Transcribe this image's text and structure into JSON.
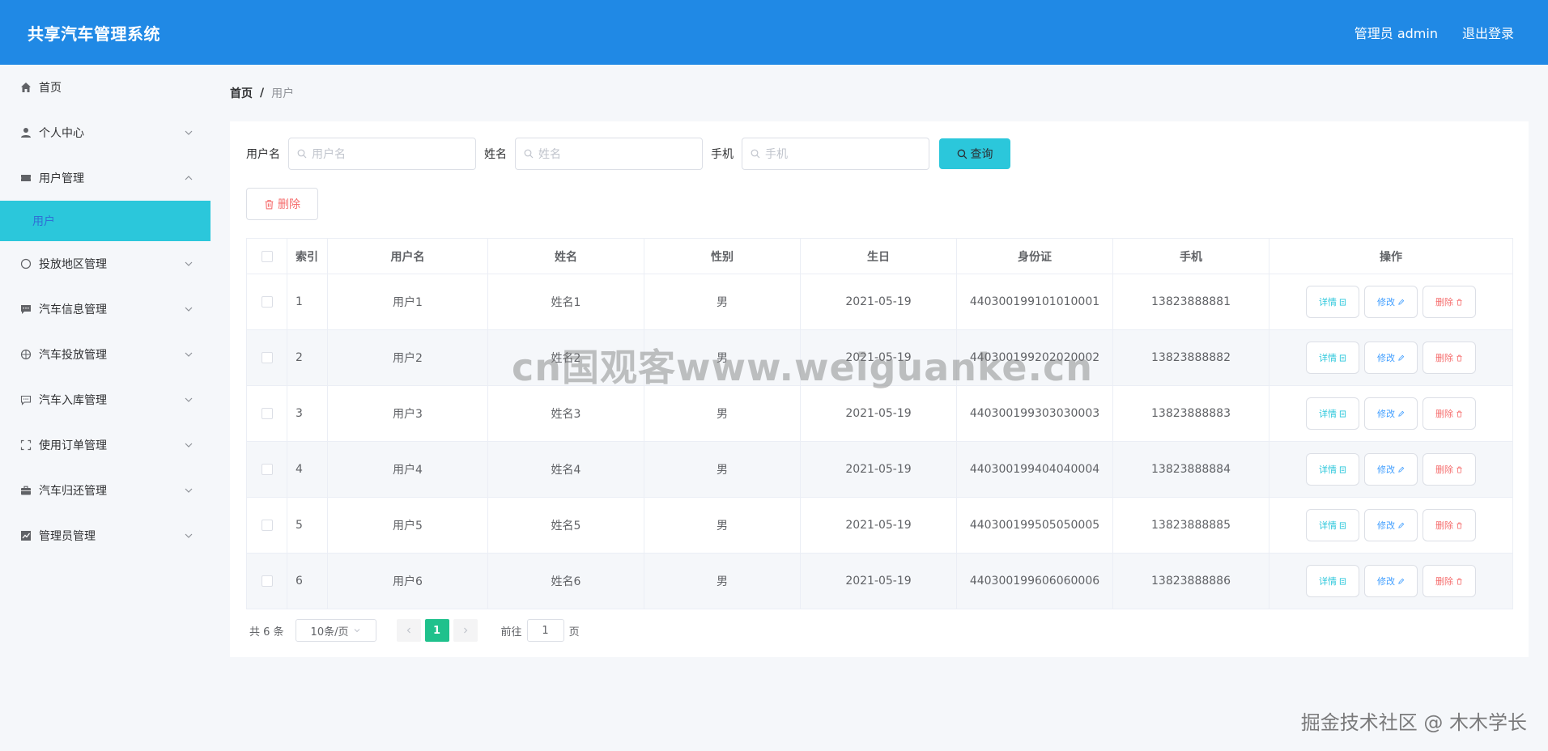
{
  "header": {
    "title": "共享汽车管理系统",
    "user": "管理员 admin",
    "logout": "退出登录"
  },
  "sidebar": {
    "items": [
      {
        "label": "首页",
        "icon": "home-icon"
      },
      {
        "label": "个人中心",
        "icon": "user-icon"
      },
      {
        "label": "用户管理",
        "icon": "ticket-icon"
      },
      {
        "label": "投放地区管理",
        "icon": "compass-icon"
      },
      {
        "label": "汽车信息管理",
        "icon": "message-icon"
      },
      {
        "label": "汽车投放管理",
        "icon": "globe-icon"
      },
      {
        "label": "汽车入库管理",
        "icon": "chat-icon"
      },
      {
        "label": "使用订单管理",
        "icon": "fullscreen-icon"
      },
      {
        "label": "汽车归还管理",
        "icon": "briefcase-icon"
      },
      {
        "label": "管理员管理",
        "icon": "chart-icon"
      }
    ],
    "active_sub": "用户"
  },
  "breadcrumb": {
    "home": "首页",
    "sep": "/",
    "current": "用户"
  },
  "search": {
    "username_label": "用户名",
    "username_placeholder": "用户名",
    "name_label": "姓名",
    "name_placeholder": "姓名",
    "phone_label": "手机",
    "phone_placeholder": "手机",
    "button": "查询"
  },
  "delete_button": "删除",
  "table": {
    "headers": [
      "索引",
      "用户名",
      "姓名",
      "性别",
      "生日",
      "身份证",
      "手机",
      "操作"
    ],
    "rows": [
      {
        "idx": "1",
        "username": "用户1",
        "name": "姓名1",
        "gender": "男",
        "birthday": "2021-05-19",
        "id_card": "440300199101010001",
        "phone": "13823888881"
      },
      {
        "idx": "2",
        "username": "用户2",
        "name": "姓名2",
        "gender": "男",
        "birthday": "2021-05-19",
        "id_card": "440300199202020002",
        "phone": "13823888882"
      },
      {
        "idx": "3",
        "username": "用户3",
        "name": "姓名3",
        "gender": "男",
        "birthday": "2021-05-19",
        "id_card": "440300199303030003",
        "phone": "13823888883"
      },
      {
        "idx": "4",
        "username": "用户4",
        "name": "姓名4",
        "gender": "男",
        "birthday": "2021-05-19",
        "id_card": "440300199404040004",
        "phone": "13823888884"
      },
      {
        "idx": "5",
        "username": "用户5",
        "name": "姓名5",
        "gender": "男",
        "birthday": "2021-05-19",
        "id_card": "440300199505050005",
        "phone": "13823888885"
      },
      {
        "idx": "6",
        "username": "用户6",
        "name": "姓名6",
        "gender": "男",
        "birthday": "2021-05-19",
        "id_card": "440300199606060006",
        "phone": "13823888886"
      }
    ],
    "actions": {
      "detail": "详情",
      "edit": "修改",
      "delete": "删除"
    }
  },
  "pager": {
    "total": "共 6 条",
    "page_size": "10条/页",
    "current_page": "1",
    "goto_label": "前往",
    "goto_value": "1",
    "goto_suffix": "页"
  },
  "watermark": "cn国观客www.weiguanke.cn",
  "credit": "掘金技术社区 @ 木木学长",
  "colors": {
    "header": "#2089e5",
    "accent": "#2bc7db",
    "page_active": "#1fc18c",
    "danger": "#f56c6c"
  }
}
